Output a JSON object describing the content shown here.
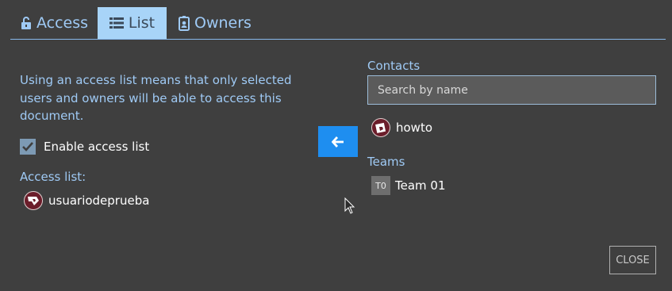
{
  "tabs": [
    {
      "label": "Access",
      "icon": "unlock-icon"
    },
    {
      "label": "List",
      "icon": "list-icon",
      "active": true
    },
    {
      "label": "Owners",
      "icon": "id-badge-icon"
    }
  ],
  "left": {
    "description": "Using an access list means that only selected users and owners will be able to access this document.",
    "enable_label": "Enable access list",
    "enable_checked": true,
    "access_list_label": "Access list:",
    "access_list": [
      {
        "name": "usuariodeprueba"
      }
    ]
  },
  "right": {
    "contacts_label": "Contacts",
    "search_placeholder": "Search by name",
    "contacts": [
      {
        "name": "howto"
      }
    ],
    "teams_label": "Teams",
    "teams": [
      {
        "badge": "T0",
        "name": "Team 01"
      }
    ]
  },
  "footer": {
    "close_label": "CLOSE"
  },
  "colors": {
    "accent": "#1e8ef0",
    "tab_active": "#a8d4f8",
    "text_blue": "#9fcaf5",
    "background": "#3f3f3f"
  }
}
